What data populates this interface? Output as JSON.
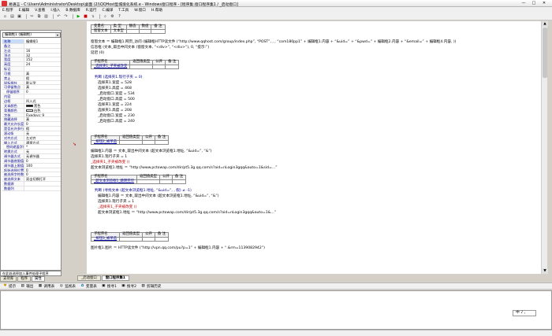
{
  "window": {
    "title": "易语言 - C:\\Users\\Administrator\\Desktop\\桌面 (2)\\QQHost型城境化系统.e - Windows窗口程序 - [程序集:窗口程序集1 / _启动窗口]",
    "minimize": "—",
    "maximize": "□",
    "close": "✕"
  },
  "menu": [
    "E.程序",
    "E.编辑",
    "V.查看",
    "I.插入",
    "B.数据库",
    "R.运行",
    "C.编译",
    "T.工具",
    "W.窗口",
    "H.帮助"
  ],
  "toolbar": {
    "icons": [
      "new-icon",
      "open-icon",
      "save-icon",
      "cut-icon",
      "copy-icon",
      "paste-icon",
      "undo-icon",
      "redo-icon",
      "run-icon",
      "stop-icon",
      "step-icon",
      "find-icon",
      "compile-icon",
      "help-icon"
    ]
  },
  "left_panel": {
    "component": "编辑框1 (编辑框)",
    "properties": [
      [
        "名称",
        "编辑框1"
      ],
      [
        "备注",
        ""
      ],
      [
        "左边",
        "16"
      ],
      [
        "顶边",
        "32"
      ],
      [
        "宽度",
        "152"
      ],
      [
        "高度",
        "24"
      ],
      [
        "标记",
        ""
      ],
      [
        "可视",
        "真"
      ],
      [
        "禁止",
        "假"
      ],
      [
        "鼠标指针",
        "默认型"
      ],
      [
        "可停留焦点",
        "真"
      ],
      [
        "停留顺序",
        "0"
      ],
      [
        "内容",
        ""
      ],
      [
        "边框",
        "凹入式"
      ],
      [
        "文本颜色",
        "黑色"
      ],
      [
        "背景颜色",
        "白色"
      ],
      [
        "字体",
        "Fixedsys: 9"
      ],
      [
        "隐藏选择",
        "真"
      ],
      [
        "最大允许长度",
        "0"
      ],
      [
        "是否允许多行",
        "假"
      ],
      [
        "滚动条",
        "无"
      ],
      [
        "对齐方式",
        "左对齐"
      ],
      [
        "输入方式",
        "通常方式"
      ],
      [
        "密码遮盖字符",
        "*"
      ],
      [
        "转换方式",
        "无"
      ],
      [
        "调节器方式",
        "无调节器"
      ],
      [
        "调节器底限值",
        "0"
      ],
      [
        "调节器上限值",
        "100"
      ],
      [
        "起始选择位置",
        "0"
      ],
      [
        "被选择字符数",
        "0"
      ],
      [
        "被选择文本",
        "双击切换打开"
      ],
      [
        "数据源",
        ""
      ],
      [
        "数据列",
        ""
      ]
    ],
    "status": "在此处选择加入事件处理子程序",
    "tabs": [
      "支持库",
      "程序",
      "属性"
    ]
  },
  "code": {
    "top_table": {
      "headers": [
        "变量名",
        "类 型",
        "静态",
        "数组",
        "备 注"
      ],
      "row": [
        "窗窗文本",
        "文本型",
        "",
        "",
        ""
      ]
    },
    "lines": [
      "窗窗文本 ＝ 编辑框1.网页_访问 (编辑框HTTP读文件 (“http://www.qqhost.com/group/index.php”, “POST”, , , “com180pp1” + 编辑框1.内容 + “&uid=” + “&pwd=” + 编辑框2.内容 + “&email=” + 编辑框4.内容, ))",
      "信息框 (文本_取出中间文本 (窗窗文本, “<div>”, “<div>”), 0, “提示:”)",
      "延迟 (0)"
    ],
    "sub1": {
      "headers": [
        "子程序名",
        "返回值类型",
        "公开",
        "备 注"
      ],
      "name": "_选择夹1_子夹被改变"
    },
    "sub1_lines": [
      "判断 (选择夹1.现行子夹 = 0)",
      "选择夹1.宽度 = 528",
      "选择夹1.高度 = 468",
      "_启动窗口.宽度 = 534",
      "_启动窗口.高度 = 500",
      "选择夹1.宽度 = 224",
      "选择夹1.高度 = 208",
      "_启动窗口.宽度 = 230",
      "_启动窗口.高度 = 240"
    ],
    "sub2": {
      "headers": [
        "子程序名",
        "返回值类型",
        "公开",
        "备 注"
      ],
      "name": "_按钮2_被单击"
    },
    "sub2_lines": [
      "编辑框1.内容 ＝ 文本_取出中间文本 (超文本浏览框1.地址, “&uid=”, “&”)",
      "选择夹1.现行子夹 = 1",
      "_选择夹1_子夹被改变 ()",
      "超文本浏览框1.地址 ＝ “http://www.pctowap.com/dir/pt5.3g.qq.com/s?aid=nLogin3gqq&auto=1&sid=...”"
    ],
    "sub3": {
      "headers": [
        "子程序名",
        "返回值类型",
        "公开",
        "备 注"
      ],
      "name": "_超文本浏览框1_跳转完毕"
    },
    "sub3_lines": [
      "判断 (寻找文本 (超文本浏览框1.地址, “&uid=”, , 假) ≠ -1)",
      "编辑框1.内容 ＝ 文本_取出中间文本 (超文本浏览框1.地址, “&uid=”, “&”)",
      "选择夹1.现行子夹 = 1",
      "_选择夹1_子夹被改变 ()",
      "超文本浏览框1.地址 ＝ “http://www.pctowap.com/dir/pt5.3g.qq.com/s?aid=nLogin3gqq&auto=1&...”"
    ],
    "sub4": {
      "headers": [
        "子程序名",
        "返回值类型",
        "公开",
        "备 注"
      ],
      "name": "_按钮3_被单击"
    },
    "sub4_lines": [
      "图片框1.图片 ＝ HTTP读文件 (“http://vpn.qq.com/pu?p=1” + 编辑框1.内容 + “.&rm=1139082942”)"
    ]
  },
  "doc_tabs": [
    "_启动窗口",
    "窗口程序集1"
  ],
  "output_toolbar": [
    {
      "icon": "hint-icon",
      "label": "提示"
    },
    {
      "icon": "output-icon",
      "label": "输出"
    },
    {
      "icon": "call-table-icon",
      "label": "调用表"
    },
    {
      "icon": "watch-icon",
      "label": "监视表"
    },
    {
      "icon": "variable-icon",
      "label": "变量表"
    },
    {
      "icon": "search1-icon",
      "label": "搜寻1"
    },
    {
      "icon": "search2-icon",
      "label": "搜寻2"
    },
    {
      "icon": "clip-history-icon",
      "label": "剪辑历史"
    }
  ],
  "ime": "中 ♪ ,"
}
